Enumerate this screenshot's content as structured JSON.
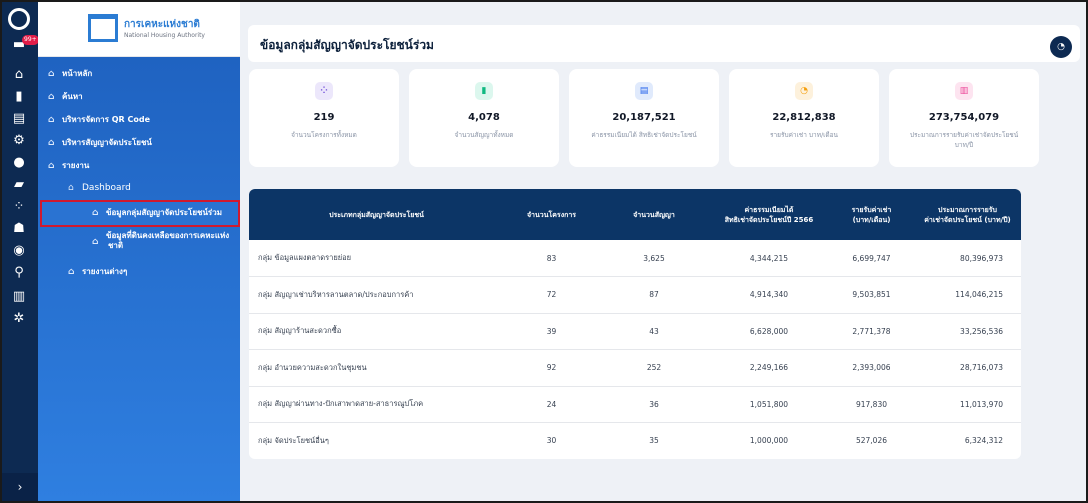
{
  "rail": {
    "badge": "99+",
    "expand": "›"
  },
  "brand": {
    "title_th": "การเคหะแห่งชาติ",
    "title_en": "National Housing Authority"
  },
  "sidebar": {
    "items": [
      {
        "label": "หน้าหลัก"
      },
      {
        "label": "ค้นหา"
      },
      {
        "label": "บริหารจัดการ QR Code"
      },
      {
        "label": "บริหารสัญญาจัดประโยชน์"
      },
      {
        "label": "รายงาน"
      },
      {
        "label": "Dashboard"
      },
      {
        "label": "ข้อมูลกลุ่มสัญญาจัดประโยชน์ร่วม"
      },
      {
        "label_line1": "ข้อมูลที่ดินคงเหลือของการเคหะแห่ง",
        "label_line2": "ชาติ"
      },
      {
        "label": "รายงานต่างๆ"
      }
    ]
  },
  "page": {
    "title": "ข้อมูลกลุ่มสัญญาจัดประโยชน์ร่วม"
  },
  "cards": [
    {
      "value": "219",
      "label": "จำนวนโครงการทั้งหมด",
      "color": "#6d4ad8",
      "bg": "#ece7fb"
    },
    {
      "value": "4,078",
      "label": "จำนวนสัญญาทั้งหมด",
      "color": "#10b981",
      "bg": "#dcf7ee"
    },
    {
      "value": "20,187,521",
      "label": "ค่าธรรมเนียมได้ สิทธิเช่าจัดประโยชน์",
      "color": "#2563eb",
      "bg": "#e0eafc"
    },
    {
      "value": "22,812,838",
      "label": "รายรับค่าเช่า บาท/เดือน",
      "color": "#f59e0b",
      "bg": "#fdf1dc"
    },
    {
      "value": "273,754,079",
      "label_line1": "ประมาณการรายรับค่าเช่าจัดประโยชน์",
      "label_line2": "บาท/ปี",
      "color": "#ec4899",
      "bg": "#fde4f0"
    }
  ],
  "table": {
    "headers": [
      {
        "l1": "ประเภทกลุ่มสัญญาจัดประโยชน์",
        "l2": ""
      },
      {
        "l1": "จำนวนโครงการ",
        "l2": ""
      },
      {
        "l1": "จำนวนสัญญา",
        "l2": ""
      },
      {
        "l1": "ค่าธรรมเนียมได้",
        "l2": "สิทธิเช่าจัดประโยชน์ปี 2566"
      },
      {
        "l1": "รายรับค่าเช่า",
        "l2": "(บาท/เดือน)"
      },
      {
        "l1": "ประมาณการรายรับ",
        "l2": "ค่าเช่าจัดประโยชน์ (บาท/ปี)"
      }
    ],
    "rows": [
      [
        "กลุ่ม ข้อมูลแผงตลาดรายย่อย",
        "83",
        "3,625",
        "4,344,215",
        "6,699,747",
        "80,396,973"
      ],
      [
        "กลุ่ม สัญญาเช่าบริหารลานตลาด/ประกอบการค้า",
        "72",
        "87",
        "4,914,340",
        "9,503,851",
        "114,046,215"
      ],
      [
        "กลุ่ม สัญญาร้านสะดวกซื้อ",
        "39",
        "43",
        "6,628,000",
        "2,771,378",
        "33,256,536"
      ],
      [
        "กลุ่ม อำนวยความสะดวกในชุมชน",
        "92",
        "252",
        "2,249,166",
        "2,393,006",
        "28,716,073"
      ],
      [
        "กลุ่ม สัญญาผ่านทาง-ปักเสาพาดสาย-สาธารณูปโภค",
        "24",
        "36",
        "1,051,800",
        "917,830",
        "11,013,970"
      ],
      [
        "กลุ่ม จัดประโยชน์อื่นๆ",
        "30",
        "35",
        "1,000,000",
        "527,026",
        "6,324,312"
      ]
    ]
  }
}
